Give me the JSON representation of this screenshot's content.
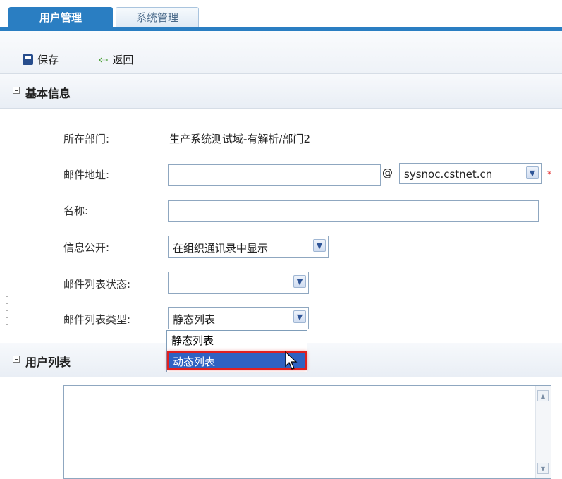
{
  "tabs": [
    {
      "label": "用户管理",
      "active": true
    },
    {
      "label": "系统管理",
      "active": false
    }
  ],
  "toolbar": {
    "save_label": "保存",
    "back_label": "返回"
  },
  "sections": {
    "basic_info": "基本信息",
    "user_list": "用户列表"
  },
  "form": {
    "department": {
      "label": "所在部门:",
      "value": "生产系统测试域-有解析/部门2"
    },
    "email": {
      "label": "邮件地址:",
      "value": "",
      "at": "@",
      "domain": "sysnoc.cstnet.cn",
      "required_mark": "*"
    },
    "name": {
      "label": "名称:",
      "value": ""
    },
    "info_public": {
      "label": "信息公开:",
      "value": "在组织通讯录中显示"
    },
    "list_status": {
      "label": "邮件列表状态:",
      "value": ""
    },
    "list_type": {
      "label": "邮件列表类型:",
      "value": "静态列表",
      "options": [
        "静态列表",
        "动态列表"
      ],
      "highlighted": "动态列表"
    }
  },
  "colors": {
    "accent": "#2a7ec2",
    "highlight": "#2f62c2",
    "required": "#e02020"
  }
}
